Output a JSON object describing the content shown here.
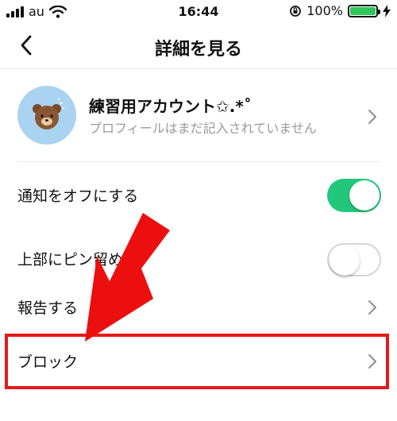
{
  "status_bar": {
    "carrier": "au",
    "time": "16:44",
    "battery_percent": "100%"
  },
  "nav": {
    "title": "詳細を見る"
  },
  "profile": {
    "name": "練習用アカウント✩.*˚",
    "status": "プロフィールはまだ記入されていません"
  },
  "settings": [
    {
      "label": "通知をオフにする",
      "toggle": true
    },
    {
      "label": "上部にピン留め",
      "toggle": false
    },
    {
      "label": "報告する"
    },
    {
      "label": "ブロック"
    }
  ],
  "colors": {
    "toggle_on": "#22c77b",
    "annotation_red": "#e61919",
    "avatar_bg": "#a9d3f0"
  }
}
